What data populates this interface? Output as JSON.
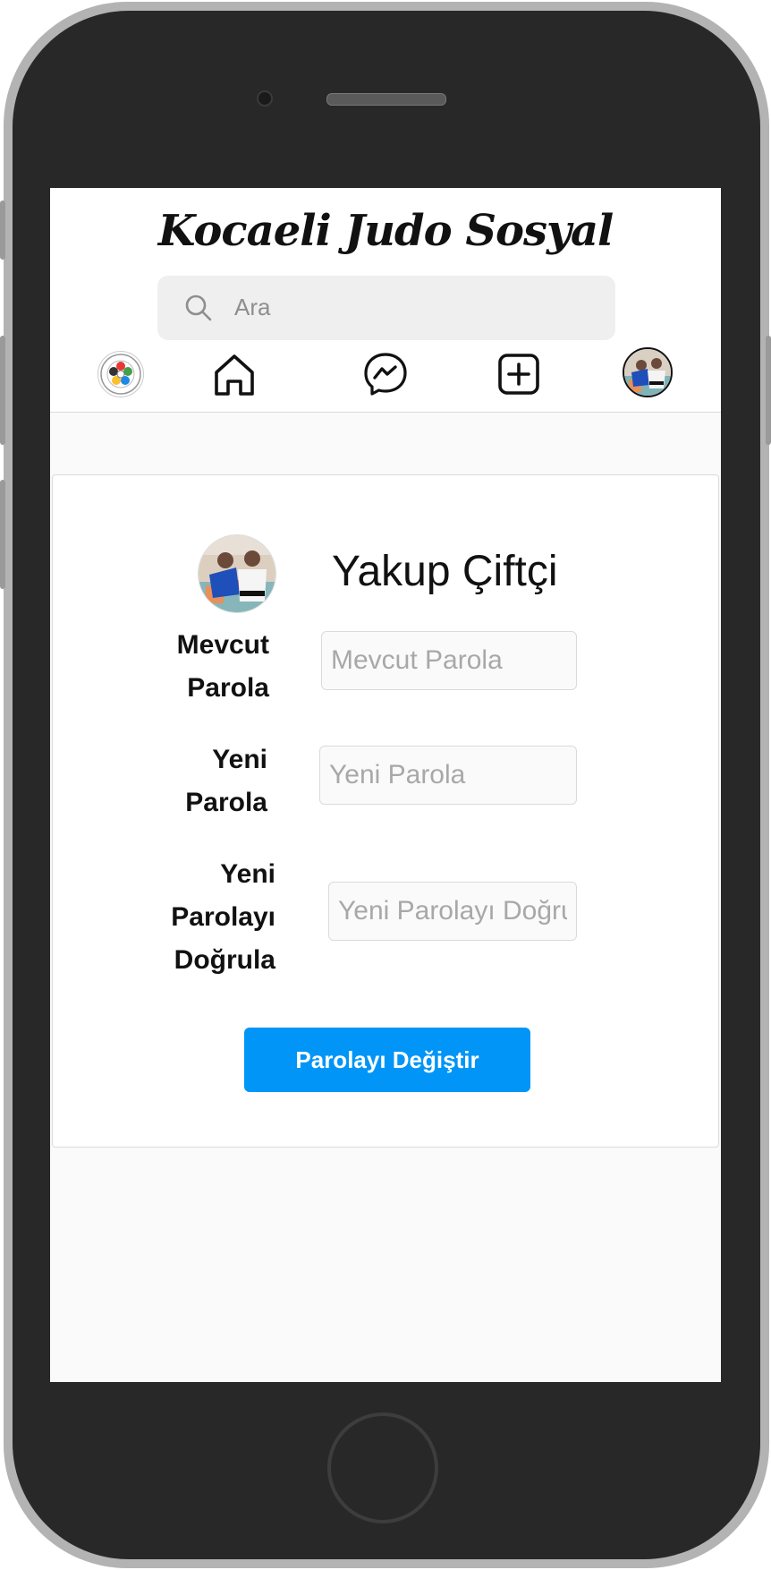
{
  "header": {
    "brand": "Kocaeli Judo Sosyal",
    "search": {
      "placeholder": "Ara"
    }
  },
  "nav": {
    "items": [
      "judo-federation-logo",
      "home-icon",
      "messenger-icon",
      "add-post-icon",
      "profile-avatar"
    ]
  },
  "profile": {
    "name": "Yakup Çiftçi"
  },
  "form": {
    "current_password": {
      "label_line1": "Mevcut",
      "label_line2": "Parola",
      "placeholder": "Mevcut Parola"
    },
    "new_password": {
      "label_line1": "Yeni",
      "label_line2": "Parola",
      "placeholder": "Yeni Parola"
    },
    "confirm_password": {
      "label_line1": "Yeni",
      "label_line2": "Parolayı",
      "label_line3": "Doğrula",
      "placeholder": "Yeni Parolayı Doğrula"
    },
    "submit_label": "Parolayı Değiştir"
  },
  "colors": {
    "accent": "#0095f6",
    "page_bg": "#fafafa",
    "search_bg": "#efefef"
  }
}
